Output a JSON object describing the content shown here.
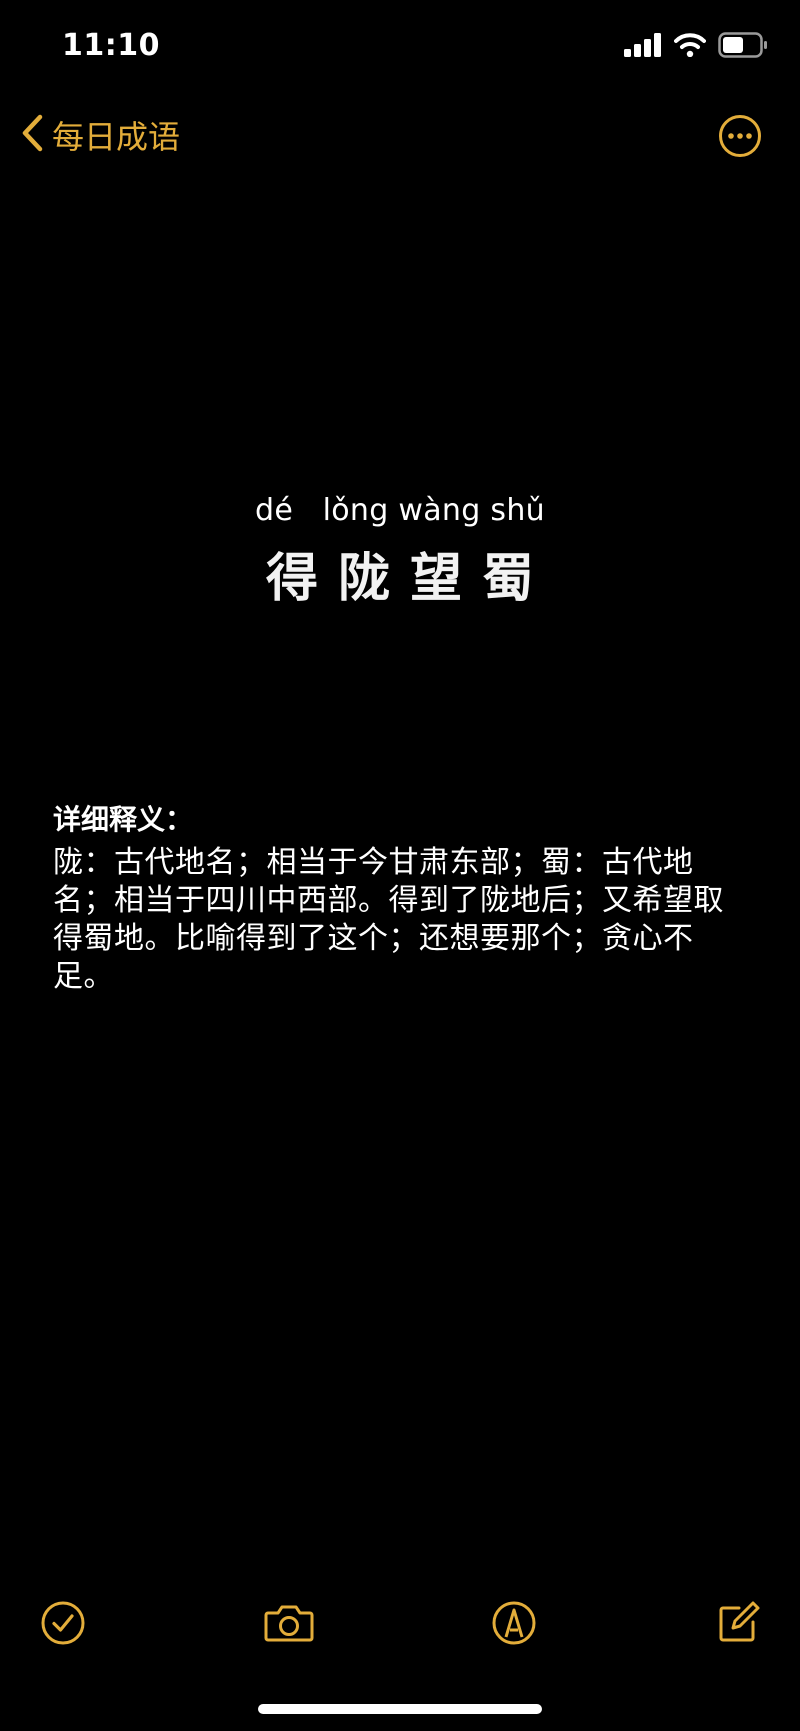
{
  "status_bar": {
    "time": "11:10",
    "icons": [
      "cellular-signal-icon",
      "wifi-icon",
      "battery-icon"
    ]
  },
  "nav": {
    "back_label": "每日成语",
    "back_icon": "chevron-left-icon",
    "more_icon": "ellipsis-circle-icon"
  },
  "idiom": {
    "pinyin": "dé   lǒng wàng shǔ",
    "title": "得陇望蜀"
  },
  "definition": {
    "heading": "详细释义：",
    "text": "陇：古代地名；相当于今甘肃东部；蜀：古代地名；相当于四川中西部。得到了陇地后；又希望取得蜀地。比喻得到了这个；还想要那个；贪心不足。"
  },
  "toolbar": {
    "icons": [
      "checklist-icon",
      "camera-icon",
      "markup-icon",
      "compose-icon"
    ]
  },
  "colors": {
    "accent": "#e3ad3a",
    "background": "#000000",
    "text": "#ffffff"
  }
}
